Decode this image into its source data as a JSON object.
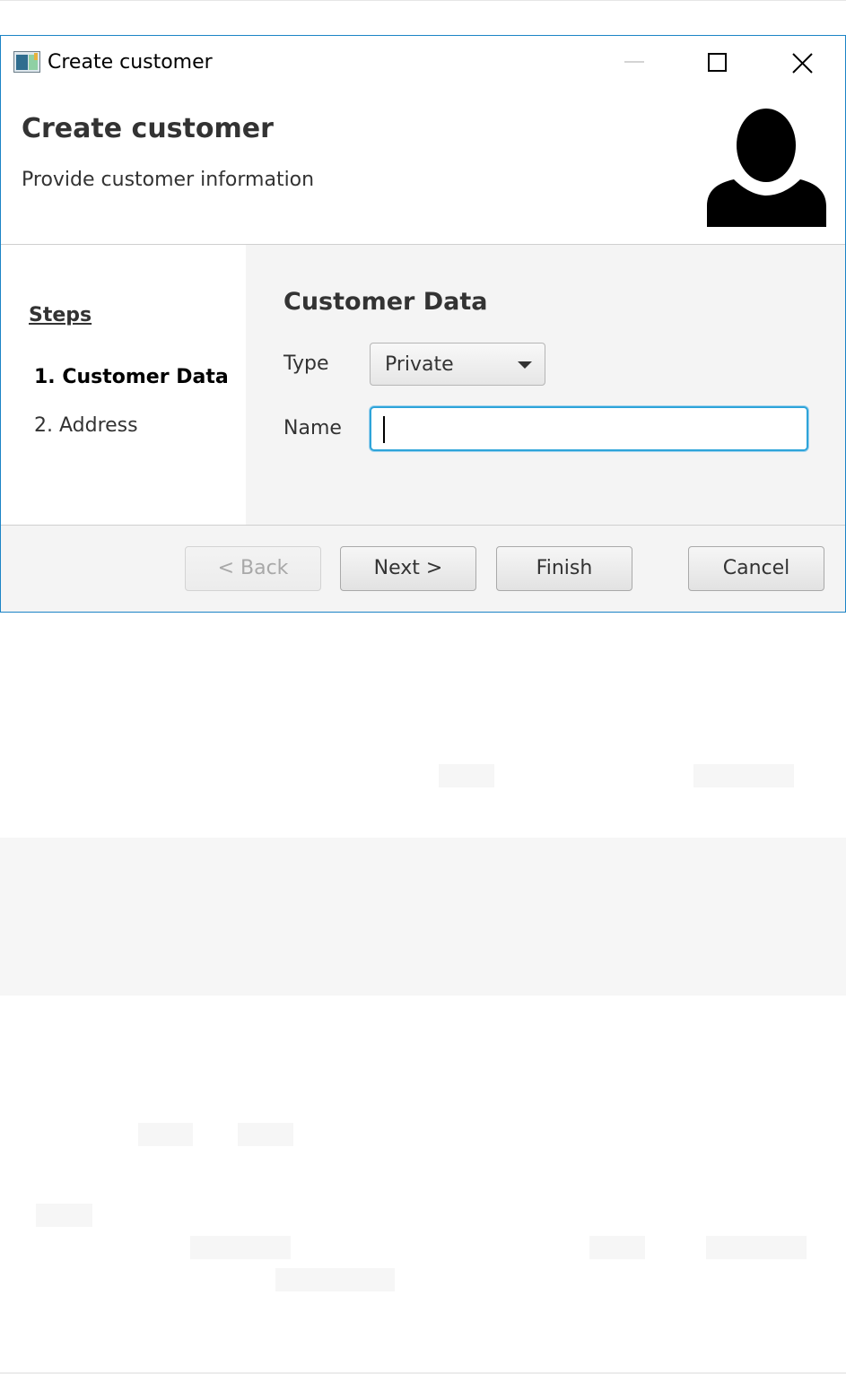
{
  "window": {
    "title": "Create customer",
    "controls": {
      "minimize": "minimize",
      "maximize": "maximize",
      "close": "close"
    }
  },
  "header": {
    "title": "Create customer",
    "subtitle": "Provide customer information",
    "avatar_icon": "user-silhouette-icon"
  },
  "steps": {
    "heading": "Steps",
    "items": [
      {
        "label": "1. Customer Data",
        "active": true
      },
      {
        "label": "2. Address",
        "active": false
      }
    ]
  },
  "form": {
    "title": "Customer Data",
    "type_label": "Type",
    "type_value": "Private",
    "name_label": "Name",
    "name_value": ""
  },
  "buttons": {
    "back": "< Back",
    "next": "Next >",
    "finish": "Finish",
    "cancel": "Cancel"
  },
  "colors": {
    "window_border": "#1c84c6",
    "focus_ring": "#2ea4d9",
    "content_background": "#f4f4f4"
  }
}
